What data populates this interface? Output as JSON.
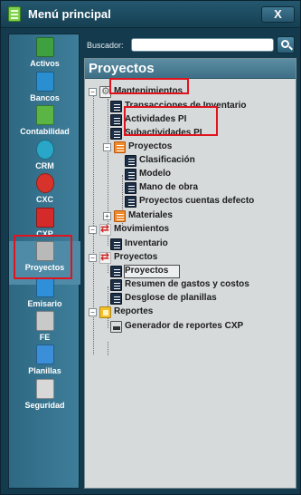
{
  "window": {
    "title": "Menú principal",
    "close_label": "X"
  },
  "sidebar": {
    "items": [
      {
        "label": "Activos",
        "icon": "activos-icon",
        "color": "#3fa040"
      },
      {
        "label": "Bancos",
        "icon": "bancos-icon",
        "color": "#2a8fd0"
      },
      {
        "label": "Contabilidad",
        "icon": "contabilidad-icon",
        "color": "#5ab545"
      },
      {
        "label": "CRM",
        "icon": "crm-icon",
        "color": "#2aa7c8"
      },
      {
        "label": "CXC",
        "icon": "cxc-icon",
        "color": "#d8332a"
      },
      {
        "label": "CXP",
        "icon": "cxp-icon",
        "color": "#d42a2a"
      },
      {
        "label": "Proyectos",
        "icon": "proyectos-icon",
        "color": "#b9b9b9"
      },
      {
        "label": "Emisario",
        "icon": "emisario-icon",
        "color": "#2f8fd8"
      },
      {
        "label": "FE",
        "icon": "fe-icon",
        "color": "#c9c9c9"
      },
      {
        "label": "Planillas",
        "icon": "planillas-icon",
        "color": "#3a8fd8"
      },
      {
        "label": "Seguridad",
        "icon": "seguridad-icon",
        "color": "#d8d8d8"
      }
    ],
    "selected": "Proyectos"
  },
  "search": {
    "label": "Buscador:",
    "value": "",
    "placeholder": ""
  },
  "panel": {
    "title": "Proyectos"
  },
  "tree": {
    "mantenimientos": {
      "label": "Mantenimientos",
      "children": [
        "Transacciones de Inventario",
        "Actividades PI",
        "Subactividades PI"
      ],
      "proyectos_folder": {
        "label": "Proyectos",
        "children": [
          "Clasificación",
          "Modelo",
          "Mano de obra",
          "Proyectos cuentas defecto"
        ]
      },
      "materiales": "Materiales"
    },
    "movimientos": {
      "label": "Movimientos",
      "children": [
        "Inventario"
      ]
    },
    "proyectos": {
      "label": "Proyectos",
      "children": [
        "Proyectos",
        "Resumen de gastos y costos",
        "Desglose de planillas"
      ]
    },
    "reportes": {
      "label": "Reportes",
      "children": [
        "Generador de reportes CXP"
      ]
    }
  },
  "colors": {
    "highlight_box": "#e0141e",
    "window_bg": "#143a4e",
    "panel_bg": "#d7dadb"
  }
}
